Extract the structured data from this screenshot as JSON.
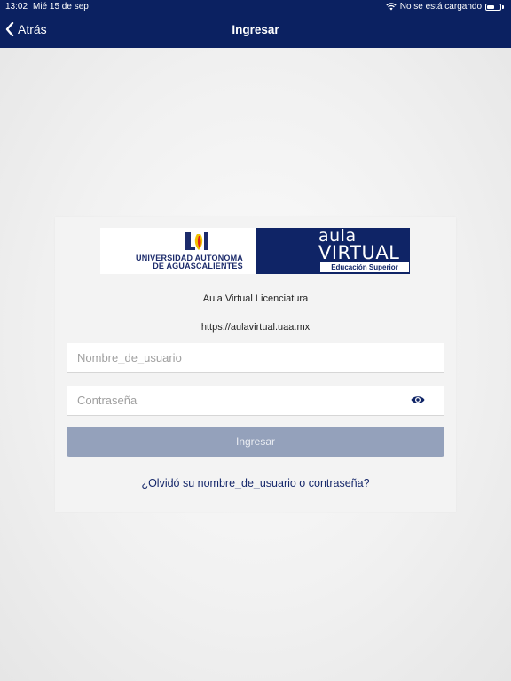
{
  "status_bar": {
    "time": "13:02",
    "date": "Mié 15 de sep",
    "charging_text": "No se está cargando",
    "battery_level": 0.55
  },
  "nav": {
    "back_label": "Atrás",
    "title": "Ingresar"
  },
  "banner": {
    "university_line1": "UNIVERSIDAD AUTONOMA",
    "university_line2": "DE AGUASCALIENTES",
    "aula": "aula",
    "virtual": "VIRTUAL",
    "subtitle": "Educación Superior"
  },
  "site": {
    "name": "Aula Virtual Licenciatura",
    "url": "https://aulavirtual.uaa.mx"
  },
  "form": {
    "username_placeholder": "Nombre_de_usuario",
    "password_placeholder": "Contraseña",
    "login_label": "Ingresar",
    "forgot_label": "¿Olvidó su nombre_de_usuario o contraseña?"
  },
  "colors": {
    "header": "#0b2161",
    "button": "#94a1bb",
    "link": "#15276a"
  },
  "icons": {
    "back": "chevron-left-icon",
    "wifi": "wifi-icon",
    "battery": "battery-icon",
    "show_password": "eye-icon"
  }
}
